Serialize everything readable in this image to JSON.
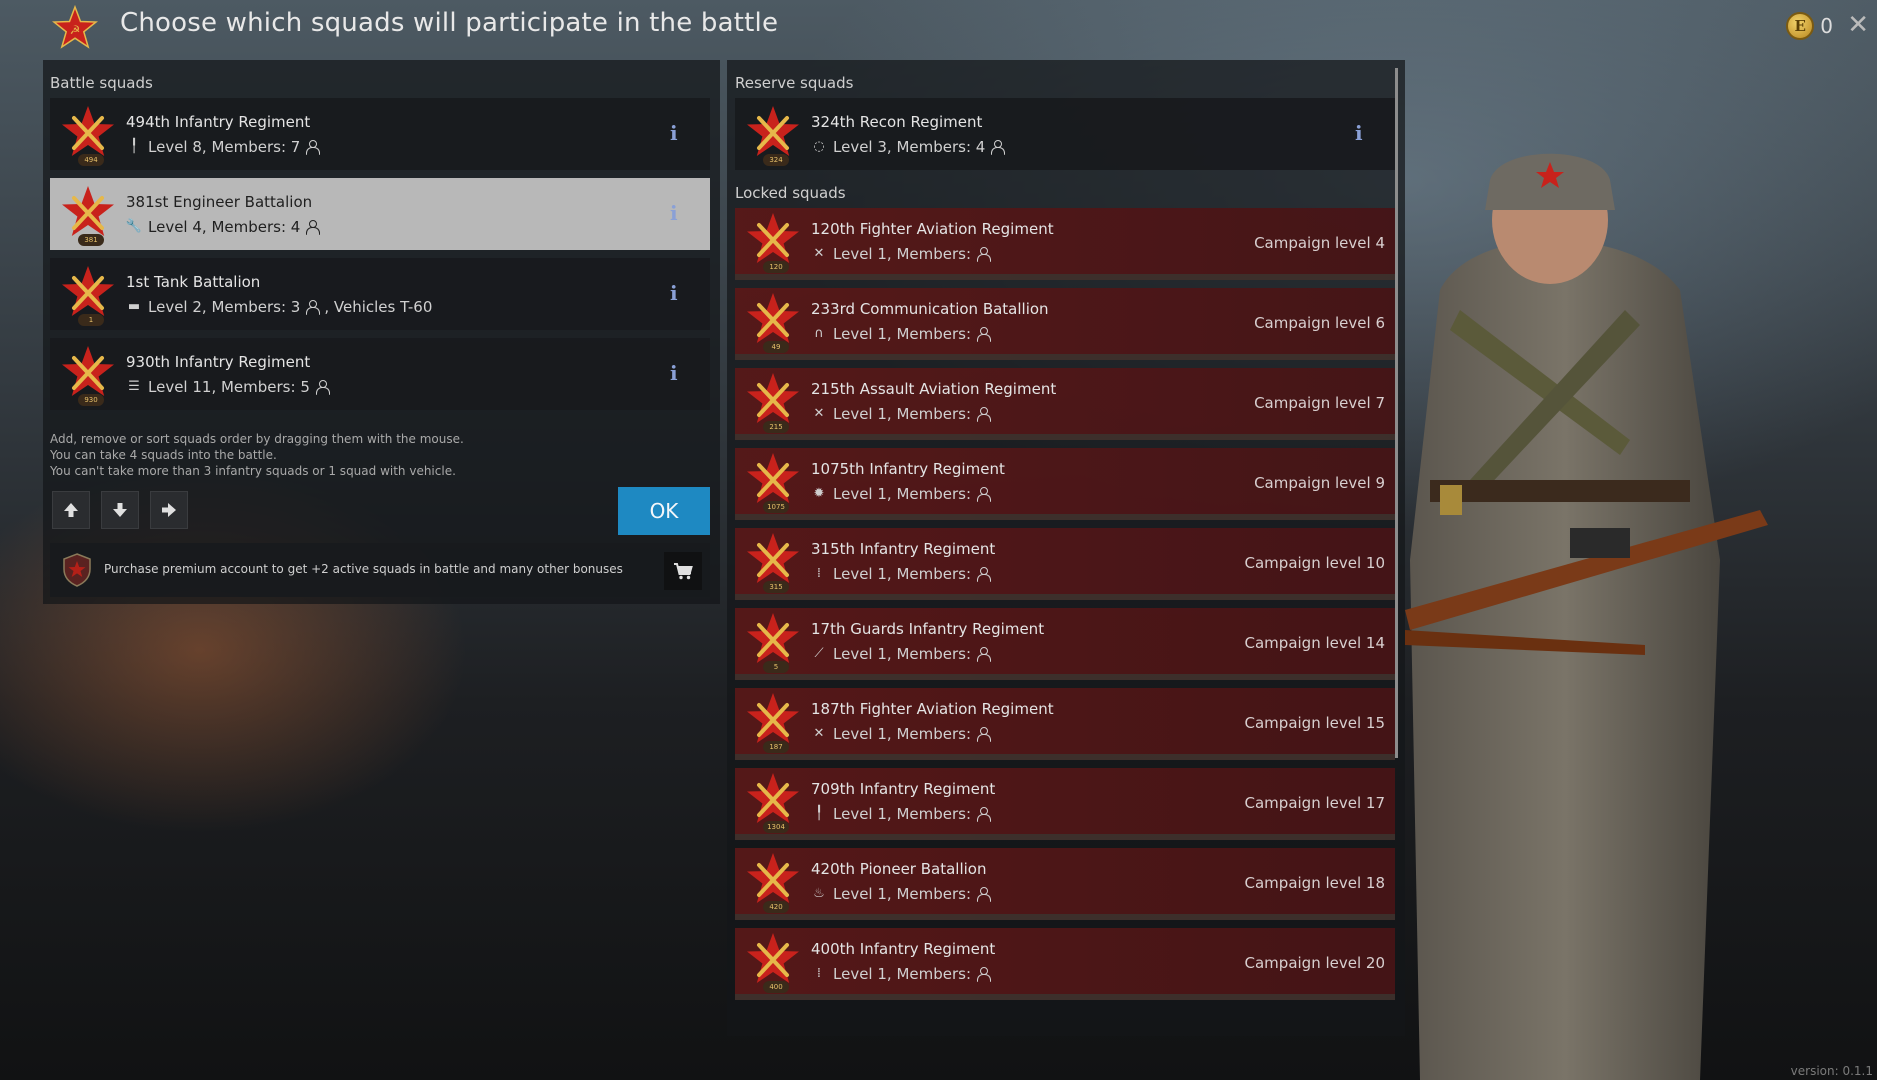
{
  "header": {
    "title": "Choose which squads will participate in the battle",
    "currency_value": "0",
    "currency_symbol": "E"
  },
  "battle_squads": {
    "label": "Battle squads",
    "items": [
      {
        "name": "494th Infantry Regiment",
        "details": "Level 8, Members: 7",
        "class_icon": "rifle-icon",
        "emblem_number": "494"
      },
      {
        "name": "381st Engineer Battalion",
        "details": "Level 4, Members: 4",
        "class_icon": "wrench-icon",
        "emblem_number": "381",
        "selected": true
      },
      {
        "name": "1st Tank Battalion",
        "details": "Level 2, Members: 3",
        "extra": ", Vehicles T-60",
        "class_icon": "tank-icon",
        "emblem_number": "1"
      },
      {
        "name": "930th Infantry Regiment",
        "details": "Level 11, Members: 5",
        "class_icon": "list-icon",
        "emblem_number": "930"
      }
    ]
  },
  "hints": [
    "Add, remove or sort squads order by dragging them with the mouse.",
    "You can take 4 squads into the battle.",
    "You can't take more than 3 infantry squads or 1 squad with vehicle."
  ],
  "ok_label": "OK",
  "premium": {
    "text": "Purchase premium account to get +2 active squads in battle and many other bonuses"
  },
  "reserve_squads": {
    "label": "Reserve squads",
    "items": [
      {
        "name": "324th Recon Regiment",
        "details": "Level 3, Members: 4",
        "class_icon": "recon-icon",
        "emblem_number": "324"
      }
    ]
  },
  "locked_squads": {
    "label": "Locked squads",
    "items": [
      {
        "name": "120th Fighter Aviation Regiment",
        "details": "Level 1, Members:",
        "requirement": "Campaign level 4",
        "class_icon": "plane-icon",
        "emblem_number": "120"
      },
      {
        "name": "233rd Communication Batallion",
        "details": "Level 1, Members:",
        "requirement": "Campaign level 6",
        "class_icon": "headphones-icon",
        "emblem_number": "49"
      },
      {
        "name": "215th Assault Aviation Regiment",
        "details": "Level 1, Members:",
        "requirement": "Campaign level 7",
        "class_icon": "plane-icon",
        "emblem_number": "215"
      },
      {
        "name": "1075th Infantry Regiment",
        "details": "Level 1, Members:",
        "requirement": "Campaign level 9",
        "class_icon": "explosion-icon",
        "emblem_number": "1075"
      },
      {
        "name": "315th Infantry Regiment",
        "details": "Level 1, Members:",
        "requirement": "Campaign level 10",
        "class_icon": "ammo-icon",
        "emblem_number": "315"
      },
      {
        "name": "17th Guards Infantry Regiment",
        "details": "Level 1, Members:",
        "requirement": "Campaign level 14",
        "class_icon": "knife-icon",
        "emblem_number": "5"
      },
      {
        "name": "187th Fighter Aviation Regiment",
        "details": "Level 1, Members:",
        "requirement": "Campaign level 15",
        "class_icon": "plane-icon",
        "emblem_number": "187"
      },
      {
        "name": "709th Infantry Regiment",
        "details": "Level 1, Members:",
        "requirement": "Campaign level 17",
        "class_icon": "rifle-icon",
        "emblem_number": "1304"
      },
      {
        "name": "420th Pioneer Batallion",
        "details": "Level 1, Members:",
        "requirement": "Campaign level 18",
        "class_icon": "flame-icon",
        "emblem_number": "420"
      },
      {
        "name": "400th Infantry Regiment",
        "details": "Level 1, Members:",
        "requirement": "Campaign level 20",
        "class_icon": "ammo-icon",
        "emblem_number": "400"
      }
    ]
  },
  "version": "version: 0.1.1",
  "colors": {
    "ok_button": "#1e89c2",
    "star_red": "#c8221c",
    "emblem_gold": "#e6b84a",
    "locked_row": "#5a1a1c",
    "info_icon": "#8aa0d6"
  }
}
